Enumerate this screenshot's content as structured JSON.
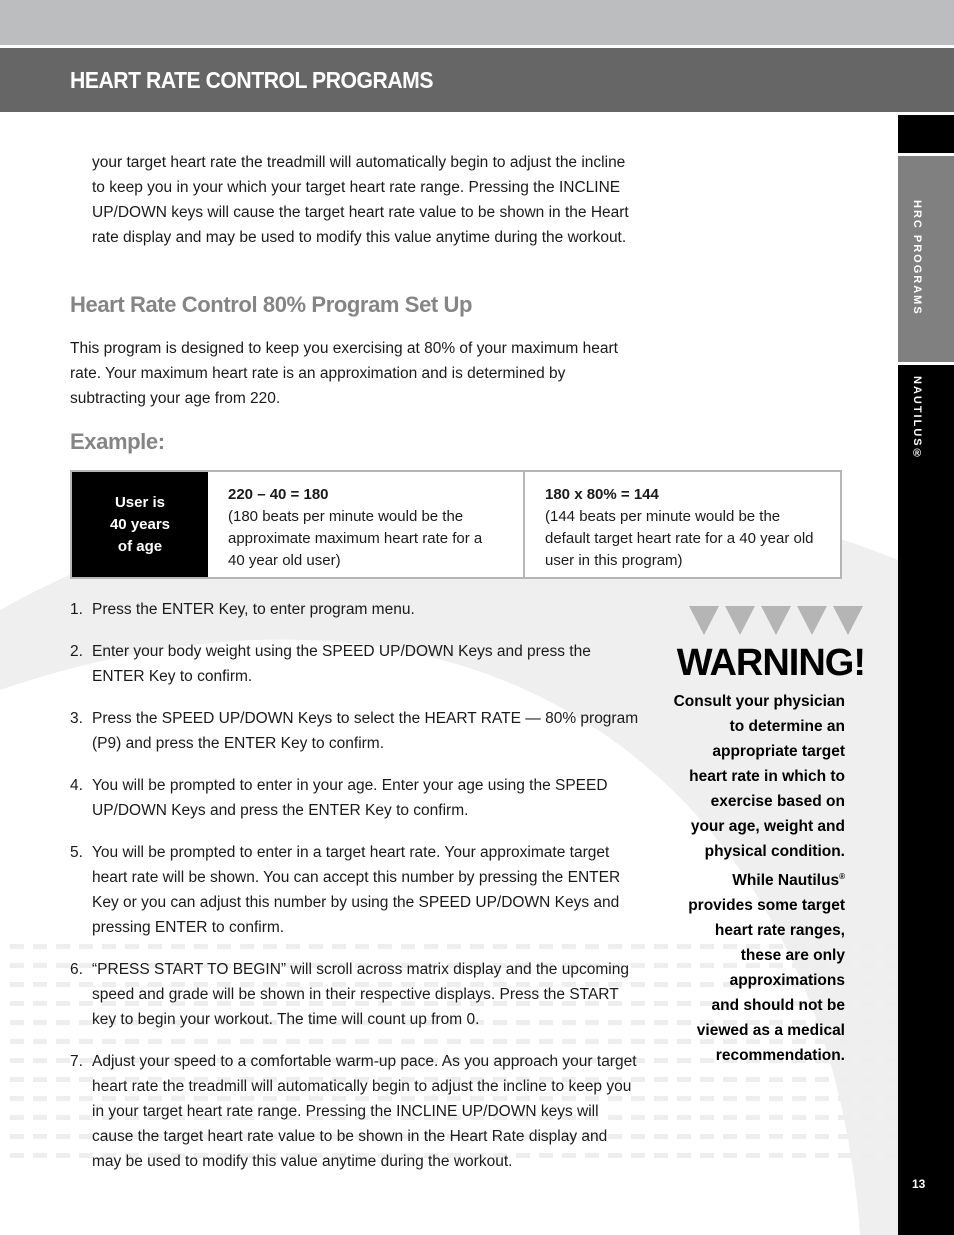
{
  "header": {
    "title": "HEART RATE CONTROL PROGRAMS"
  },
  "side_tabs": {
    "section": "HRC PROGRAMS",
    "brand": "NAUTILUS®"
  },
  "page_number": "13",
  "intro_paragraph": "your target heart rate the treadmill will automatically begin to adjust the incline to keep you in your which your target heart rate range. Pressing the INCLINE UP/DOWN keys will cause the target heart rate value to be shown in the Heart rate display and may be used to modify this value anytime during the workout.",
  "setup_section": {
    "heading": "Heart Rate Control 80% Program Set Up",
    "description": "This program is designed to keep you exercising at 80% of your maximum heart rate. Your maximum heart rate is an approximation and is determined by subtracting your age from 220."
  },
  "example": {
    "heading": "Example:",
    "age_cell": [
      "User is",
      "40 years",
      "of age"
    ],
    "cells": [
      {
        "formula": "220 – 40 = 180",
        "explanation": "(180 beats per minute would be the approximate maximum heart rate for a 40 year old user)"
      },
      {
        "formula": "180 x 80% = 144",
        "explanation": "(144 beats per minute would be the default target heart rate for a 40 year old user in this program)"
      }
    ]
  },
  "steps": [
    {
      "num": "1.",
      "text": "Press the ENTER Key, to enter program menu."
    },
    {
      "num": "2.",
      "text": "Enter your body weight using the SPEED UP/DOWN Keys and press the ENTER Key to confirm."
    },
    {
      "num": "3.",
      "text": "Press the SPEED UP/DOWN Keys to select the HEART RATE — 80% program (P9) and press the ENTER Key to confirm."
    },
    {
      "num": "4.",
      "text": "You will be prompted to enter in your age. Enter your age using the SPEED UP/DOWN Keys and press the ENTER Key to confirm."
    },
    {
      "num": "5.",
      "text": "You will be prompted to enter in a target heart rate. Your approximate target heart rate will be shown. You can accept this number by pressing the ENTER Key or you can adjust this number by using the SPEED UP/DOWN Keys and pressing ENTER to confirm."
    },
    {
      "num": "6.",
      "text": "“PRESS START TO BEGIN” will scroll across matrix display and the upcoming speed and grade will be shown in their respective displays. Press the START key to begin your workout. The time will count up from 0."
    },
    {
      "num": "7.",
      "text": "Adjust your speed to a comfortable warm-up pace. As you approach your target heart rate the treadmill will automatically begin to adjust the incline to keep you in your target heart rate range. Pressing the INCLINE UP/DOWN keys will cause the target heart rate value to be shown in the Heart Rate display and may be used to modify this value anytime during the workout."
    }
  ],
  "warning": {
    "icon": "warning-triangles-icon",
    "title": "WARNING!",
    "lines": [
      "Consult your physician",
      "to determine an",
      "appropriate target",
      "heart rate in which to",
      "exercise based on",
      "your age, weight and",
      "physical condition.",
      "While Nautilus®",
      "provides some target",
      "heart rate ranges,",
      "these are only",
      "approximations",
      "and should not be",
      "viewed as a medical",
      "recommendation."
    ]
  },
  "colors": {
    "top_band": "#bcbdbf",
    "header_band": "#666666",
    "heading_gray": "#858585",
    "side_tab_gray": "#808080",
    "side_tab_black": "#000000"
  }
}
